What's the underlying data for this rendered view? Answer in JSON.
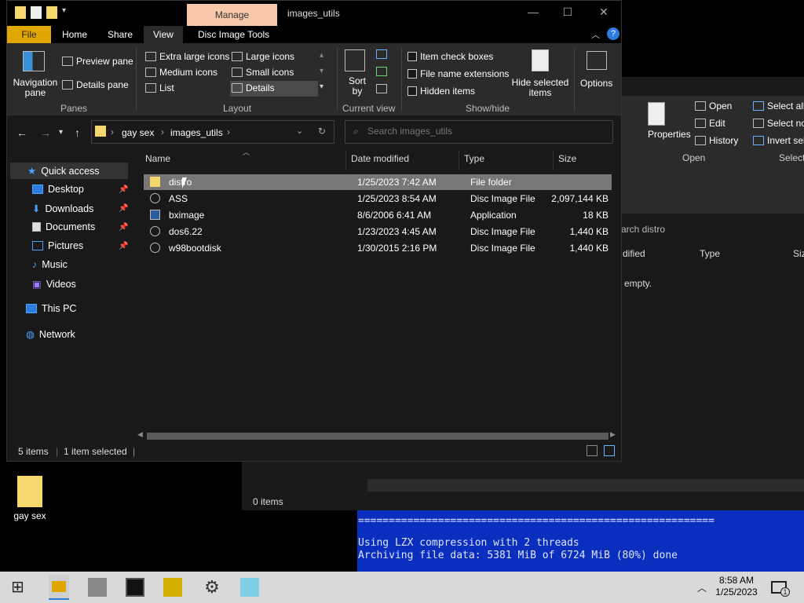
{
  "window": {
    "title": "images_utils",
    "context_tab": "Manage",
    "tabs": [
      "File",
      "Home",
      "Share",
      "View",
      "Disc Image Tools"
    ]
  },
  "ribbon": {
    "panes": {
      "navigation": "Navigation pane",
      "preview": "Preview pane",
      "details": "Details pane",
      "group": "Panes"
    },
    "layout": {
      "options": [
        "Extra large icons",
        "Large icons",
        "Medium icons",
        "Small icons",
        "List",
        "Details"
      ],
      "selected": "Details",
      "group": "Layout"
    },
    "current_view": {
      "sort": "Sort by",
      "group": "Current view"
    },
    "show_hide": {
      "item_check_boxes": "Item check boxes",
      "file_name_extensions": "File name extensions",
      "hidden_items": "Hidden items",
      "hide_selected": "Hide selected items",
      "group": "Show/hide"
    },
    "options": "Options"
  },
  "address": {
    "segments": [
      "gay sex",
      "images_utils"
    ],
    "search_placeholder": "Search images_utils"
  },
  "sidebar": {
    "items": [
      {
        "label": "Quick access",
        "pinned": false
      },
      {
        "label": "Desktop",
        "pinned": true
      },
      {
        "label": "Downloads",
        "pinned": true
      },
      {
        "label": "Documents",
        "pinned": true
      },
      {
        "label": "Pictures",
        "pinned": true
      },
      {
        "label": "Music",
        "pinned": false
      },
      {
        "label": "Videos",
        "pinned": false
      },
      {
        "label": "This PC",
        "pinned": false
      },
      {
        "label": "Network",
        "pinned": false
      }
    ]
  },
  "files": {
    "columns": [
      "Name",
      "Date modified",
      "Type",
      "Size"
    ],
    "rows": [
      {
        "name": "distro",
        "date": "1/25/2023 7:42 AM",
        "type": "File folder",
        "size": ""
      },
      {
        "name": "ASS",
        "date": "1/25/2023 8:54 AM",
        "type": "Disc Image File",
        "size": "2,097,144 KB"
      },
      {
        "name": "bximage",
        "date": "8/6/2006 6:41 AM",
        "type": "Application",
        "size": "18 KB"
      },
      {
        "name": "dos6.22",
        "date": "1/23/2023 4:45 AM",
        "type": "Disc Image File",
        "size": "1,440 KB"
      },
      {
        "name": "w98bootdisk",
        "date": "1/30/2015 2:16 PM",
        "type": "Disc Image File",
        "size": "1,440 KB"
      }
    ]
  },
  "status": {
    "count": "5 items",
    "selected": "1 item selected"
  },
  "bgwin": {
    "open": "Open",
    "edit": "Edit",
    "history": "History",
    "properties": "Properties",
    "select_all": "Select all",
    "select_none": "Select no",
    "invert": "Invert sel",
    "group_open": "Open",
    "group_select": "Select",
    "search": "arch distro",
    "col_modified": "dified",
    "col_type": "Type",
    "col_size": "Siz",
    "empty": "empty."
  },
  "lower": {
    "count": "0 items"
  },
  "console": {
    "lines": [
      "==========================================================",
      "Using LZX compression with 2 threads",
      "Archiving file data: 5381 MiB of 6724 MiB (80%) done"
    ]
  },
  "desktop": {
    "icon_label": "gay sex"
  },
  "taskbar": {
    "time": "8:58 AM",
    "date": "1/25/2023",
    "notif": "1"
  }
}
